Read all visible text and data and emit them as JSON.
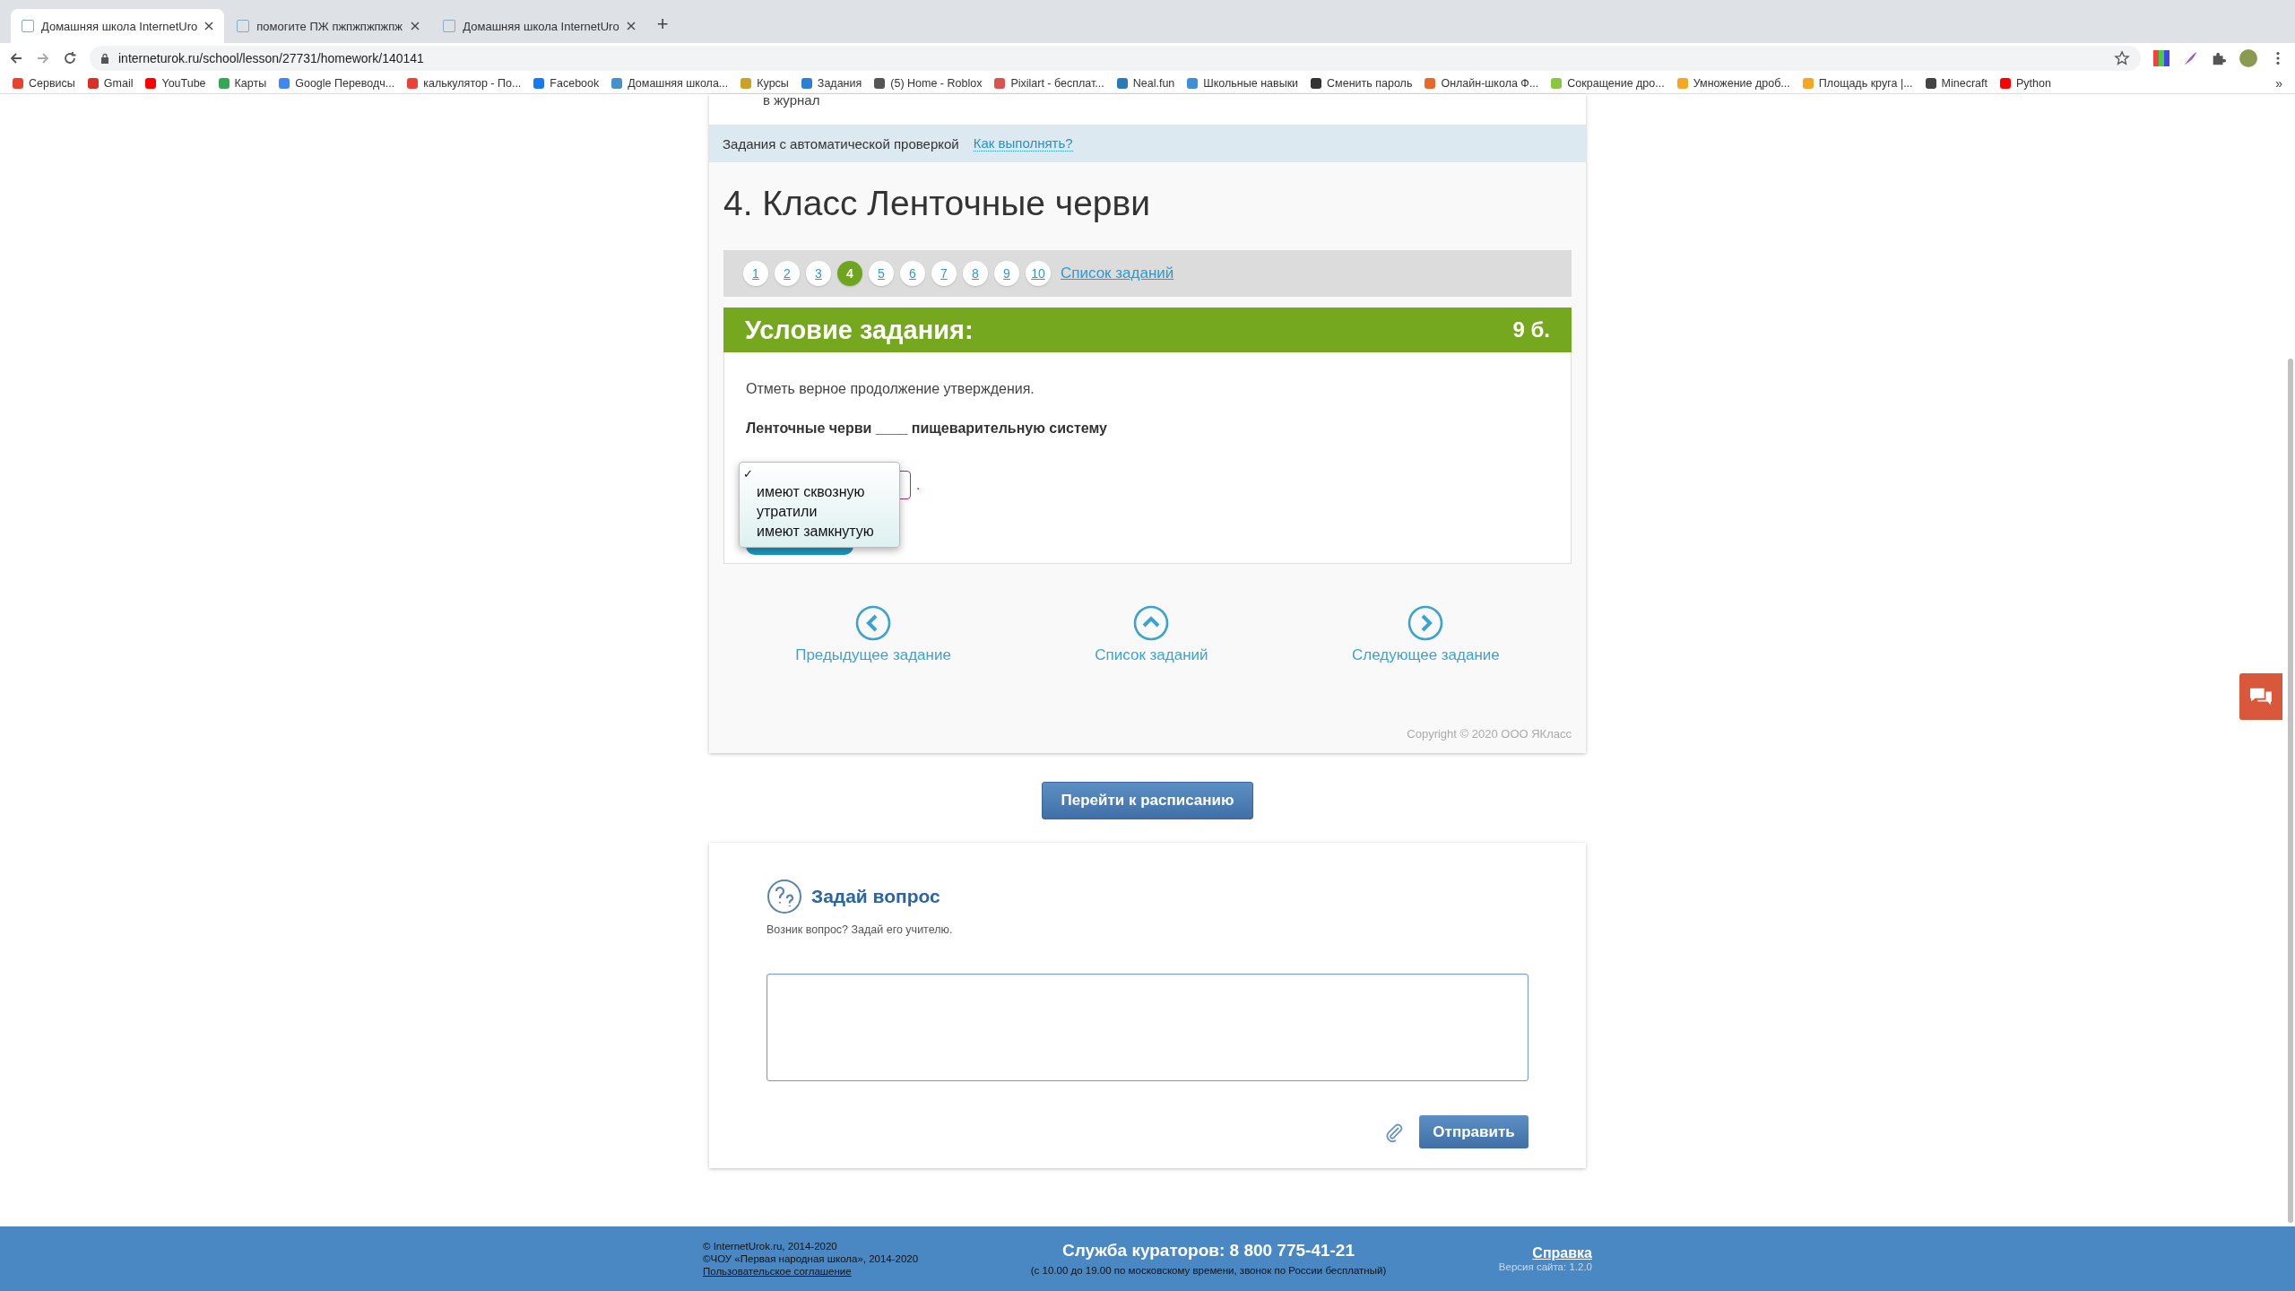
{
  "browser": {
    "tabs": [
      {
        "title": "Домашняя школа InternetUro",
        "selected": true
      },
      {
        "title": "помогите ПЖ пжпжпжпжпж",
        "selected": false
      },
      {
        "title": "Домашняя школа InternetUro",
        "selected": false
      }
    ],
    "new_tab": "+",
    "url": "interneturok.ru/school/lesson/27731/homework/140141",
    "bookmarks": [
      {
        "label": "Сервисы",
        "color": "#e94235"
      },
      {
        "label": "Gmail",
        "color": "#d93025"
      },
      {
        "label": "YouTube",
        "color": "#ff0000"
      },
      {
        "label": "Карты",
        "color": "#34a853"
      },
      {
        "label": "Google Переводч...",
        "color": "#4285f4"
      },
      {
        "label": "калькулятор - По...",
        "color": "#ea4335"
      },
      {
        "label": "Facebook",
        "color": "#1877f2"
      },
      {
        "label": "Домашняя школа...",
        "color": "#4a90c8"
      },
      {
        "label": "Курсы",
        "color": "#c9a227"
      },
      {
        "label": "Задания",
        "color": "#2d7fd3"
      },
      {
        "label": "(5) Home - Roblox",
        "color": "#555555"
      },
      {
        "label": "Pixilart - бесплат...",
        "color": "#d9534f"
      },
      {
        "label": "Neal.fun",
        "color": "#2a7ab8"
      },
      {
        "label": "Школьные навыки",
        "color": "#3f8fd8"
      },
      {
        "label": "Сменить пароль",
        "color": "#333333"
      },
      {
        "label": "Онлайн-школа Ф...",
        "color": "#e8682a"
      },
      {
        "label": "Сокращение дро...",
        "color": "#8cc63f"
      },
      {
        "label": "Умножение дроб...",
        "color": "#f5a623"
      },
      {
        "label": "Площадь круга |...",
        "color": "#f5a623"
      },
      {
        "label": "Minecraft",
        "color": "#444444"
      },
      {
        "label": "Python",
        "color": "#ff0000"
      }
    ],
    "more": "»"
  },
  "page": {
    "journal_note": "в журнал",
    "auto_check": {
      "label": "Задания с автоматической проверкой",
      "link": "Как выполнять?"
    },
    "title": "4. Класс Ленточные черви",
    "pagination": [
      {
        "label": "1",
        "selected": false
      },
      {
        "label": "2",
        "selected": false
      },
      {
        "label": "3",
        "selected": false
      },
      {
        "label": "4",
        "selected": true
      },
      {
        "label": "5",
        "selected": false
      },
      {
        "label": "6",
        "selected": false
      },
      {
        "label": "7",
        "selected": false
      },
      {
        "label": "8",
        "selected": false
      },
      {
        "label": "9",
        "selected": false
      },
      {
        "label": "10",
        "selected": false
      }
    ],
    "task_list_link": "Список заданий",
    "task": {
      "header": "Условие задания:",
      "points": "9 б.",
      "instruction": "Отметь верное продолжение утверждения.",
      "statement": "Ленточные черви ____ пищеварительную систему",
      "after_select": ".",
      "dropdown": {
        "blank_option": {
          "mark": "✓",
          "selected": true
        },
        "options": [
          {
            "label": "имеют сквозную",
            "selected": false
          },
          {
            "label": "утратили",
            "selected": false
          },
          {
            "label": "имеют замкнутую",
            "selected": false
          }
        ]
      }
    },
    "nav": [
      {
        "kind": "prev",
        "label": "Предыдущее задание"
      },
      {
        "kind": "up",
        "label": "Список заданий"
      },
      {
        "kind": "next",
        "label": "Следующее задание"
      }
    ],
    "copyright": "Copyright © 2020 ООО ЯКласс",
    "schedule_button": "Перейти к расписанию",
    "ask": {
      "title": "Задай вопрос",
      "subtitle": "Возник вопрос? Задай его учителю.",
      "send": "Отправить"
    }
  },
  "footer": {
    "left": [
      "© InternetUrok.ru, 2014-2020",
      "©ЧОУ «Первая народная школа», 2014-2020"
    ],
    "agreement": "Пользовательское соглашение",
    "phone": "Служба кураторов: 8 800 775-41-21",
    "hours": "(с 10.00 до 19.00 по московскому времени, звонок по России бесплатный)",
    "help": "Справка",
    "version": "Версия сайта: 1.2.0"
  }
}
